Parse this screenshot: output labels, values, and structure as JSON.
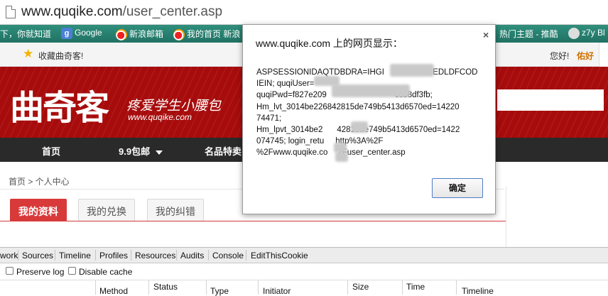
{
  "browser": {
    "url_domain": "www.quqike.com",
    "url_path": "/user_center.asp"
  },
  "bookmarks": [
    {
      "label": "下，你就知道",
      "icon": "none"
    },
    {
      "label": "Google",
      "icon": "google-icon"
    },
    {
      "label": "新浪邮箱",
      "icon": "weibo-icon"
    },
    {
      "label": "我的首页 新浪",
      "icon": "weibo-icon"
    },
    {
      "label": "热门主题 - 推酷",
      "icon": "none"
    },
    {
      "label": "z7y Bl",
      "icon": "avatar-icon"
    }
  ],
  "site": {
    "favorite_label": "收藏曲奇客!",
    "greeting": "您好!",
    "username": "佑好",
    "logo_text": "曲奇客",
    "slogan": "疼爱学生小腰包",
    "site_url": "www.quqike.com",
    "nav": [
      {
        "label": "首页"
      },
      {
        "label": "9.9包邮"
      },
      {
        "label": "名品特卖"
      }
    ],
    "breadcrumb": "首页 > 个人中心",
    "tabs": [
      {
        "label": "我的资料"
      },
      {
        "label": "我的兑换"
      },
      {
        "label": "我的纠错"
      }
    ]
  },
  "devtools": {
    "tabs": [
      "work",
      "Sources",
      "Timeline",
      "Profiles",
      "Resources",
      "Audits",
      "Console",
      "EditThisCookie"
    ],
    "options": [
      "Preserve log",
      "Disable cache"
    ],
    "columns": [
      "Method",
      "Status",
      "Type",
      "Initiator",
      "Size",
      "Time",
      "Timeline"
    ]
  },
  "dialog": {
    "title": "www.quqike.com 上的网页显示：",
    "close": "×",
    "message_lines": [
      "ASPSESSIONIDAQTDBDRA=IHGI",
      "NEDLDFCOD",
      "IEIN; quqiUser=",
      "quqiPwd=f827e209",
      "cc88df3fb;",
      "Hm_lvt_3014be226842815de749b5413d6570ed=14220",
      "74471;",
      "Hm_lpvt_3014be2",
      "42815de749b5413d6570ed=1422",
      "074745; login_retu",
      "http%3A%2F",
      "%2Fwww.quqike.co",
      "2Fuser_center.asp"
    ],
    "ok_label": "确定"
  }
}
